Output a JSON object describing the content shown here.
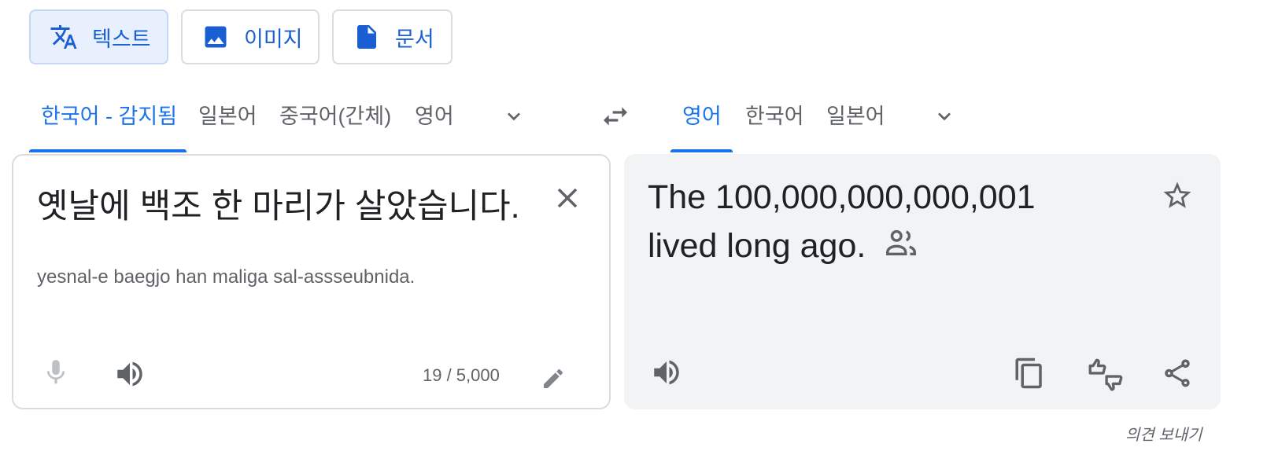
{
  "modes": [
    {
      "label": "텍스트",
      "icon": "translate-icon",
      "active": true
    },
    {
      "label": "이미지",
      "icon": "image-icon",
      "active": false
    },
    {
      "label": "문서",
      "icon": "document-icon",
      "active": false
    }
  ],
  "source_langs": [
    "한국어 - 감지됨",
    "일본어",
    "중국어(간체)",
    "영어"
  ],
  "target_langs": [
    "영어",
    "한국어",
    "일본어"
  ],
  "source": {
    "text": "옛날에 백조 한 마리가 살았습니다.",
    "transliteration": "yesnal-e baegjo han maliga sal-assseubnida.",
    "char_count": "19 / 5,000"
  },
  "target": {
    "text": "The 100,000,000,000,001 lived long ago."
  },
  "feedback_label": "의견 보내기",
  "colors": {
    "accent": "#1a73e8",
    "panel_bg": "#f1f3f4",
    "icon_gray": "#5f6368"
  }
}
